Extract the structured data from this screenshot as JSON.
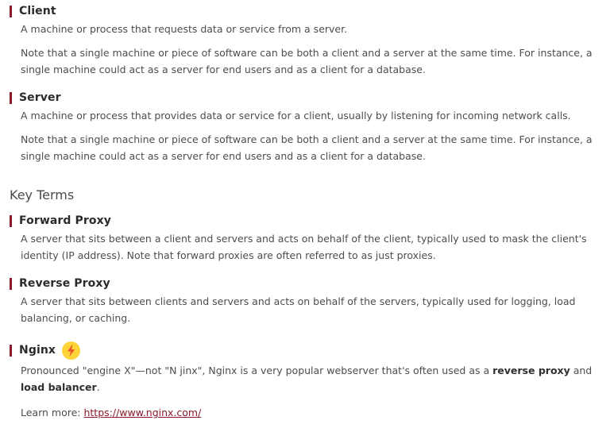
{
  "definitions": [
    {
      "title": "Client",
      "desc": "A machine or process that requests data or service from a server.",
      "note": "Note that a single machine or piece of software can be both a client and a server at the same time. For instance, a single machine could act as a server for end users and as a client for a database."
    },
    {
      "title": "Server",
      "desc": "A machine or process that provides data or service for a client, usually by listening for incoming network calls.",
      "note": "Note that a single machine or piece of software can be both a client and a server at the same time. For instance, a single machine could act as a server for end users and as a client for a database."
    }
  ],
  "key_terms_heading": "Key Terms",
  "key_terms": [
    {
      "title": "Forward Proxy",
      "desc": "A server that sits between a client and servers and acts on behalf of the client, typically used to mask the client's identity (IP address). Note that forward proxies are often referred to as just proxies."
    },
    {
      "title": "Reverse Proxy",
      "desc": "A server that sits between clients and servers and acts on behalf of the servers, typically used for logging, load balancing, or caching."
    }
  ],
  "nginx": {
    "title": "Nginx",
    "icon": "lightning-bolt-icon",
    "icon_color": "#ffd33a",
    "desc_prefix": "Pronounced \"engine X\"—not \"N jinx\", Nginx is a very popular webserver that's often used as a ",
    "desc_bold1": "reverse proxy",
    "desc_mid": " and ",
    "desc_bold2": "load balancer",
    "desc_suffix": ".",
    "learn_more_label": "Learn more: ",
    "learn_more_url": "https://www.nginx.com/"
  },
  "colors": {
    "accent": "#8b1a2b",
    "text": "#4d4d4d",
    "heading": "#2b2b2b"
  }
}
